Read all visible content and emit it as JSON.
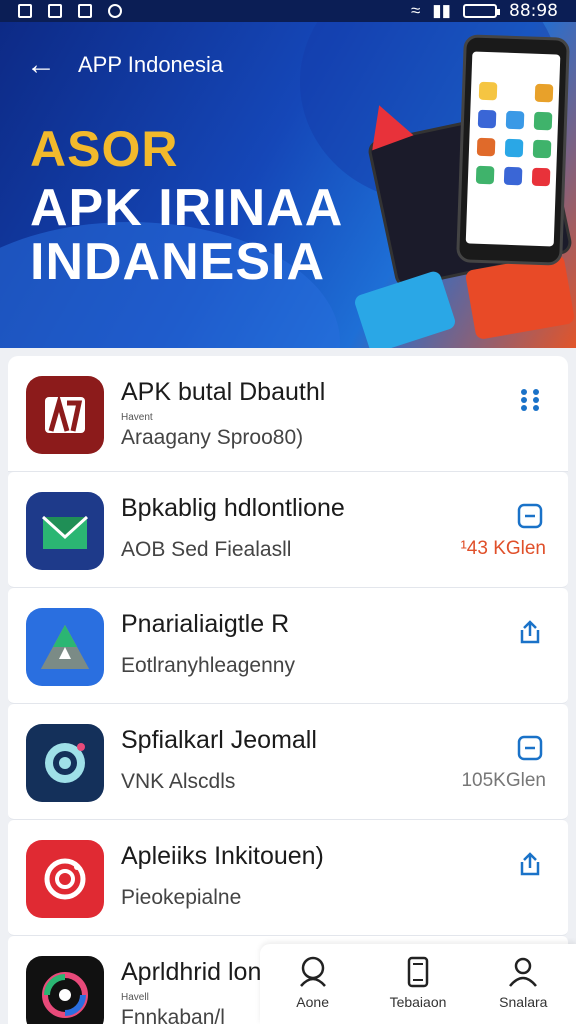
{
  "status_bar": {
    "time": "88:98"
  },
  "header": {
    "title": "APP Indonesia",
    "hero_line1": "ASOR",
    "hero_line2": "APK IRINAA",
    "hero_line3": "INDANESIA"
  },
  "apps": [
    {
      "name": "APK butal Dbauthl",
      "sub": "Havent",
      "desc": "Araagany Sproo80)",
      "action_icon": "more-dots-icon",
      "size": "",
      "icon_color": "#8c1b1b"
    },
    {
      "name": "Bpkablig hdlontlione",
      "sub": "",
      "desc": "AOB Sed Fiealasll",
      "action_icon": "square-icon",
      "size": "¹43 KGlen",
      "icon_color": "#1a8c6a"
    },
    {
      "name": "Pnarialiaigtle R",
      "sub": "",
      "desc": "Eotlranyhleagenny",
      "action_icon": "share-icon",
      "size": "",
      "icon_color": "#2a6fe0"
    },
    {
      "name": "Spfialkarl Jeomall",
      "sub": "",
      "desc": "VNK Alscdls",
      "action_icon": "square-icon",
      "size": "105KGlen",
      "icon_color": "#14305a"
    },
    {
      "name": "Apleiiks Inkitouen)",
      "sub": "",
      "desc": "Pieokepialne",
      "action_icon": "share-icon",
      "size": "",
      "icon_color": "#e02a33"
    },
    {
      "name": "Aprldhrid lon",
      "sub": "Havell",
      "desc": "Fnnkaban/l",
      "action_icon": "",
      "size": "",
      "icon_color": "#111111"
    }
  ],
  "bottom_nav": [
    {
      "label": "Aone",
      "icon": "home-icon"
    },
    {
      "label": "Tebaiaon",
      "icon": "phone-icon"
    },
    {
      "label": "Snalara",
      "icon": "profile-icon"
    }
  ]
}
